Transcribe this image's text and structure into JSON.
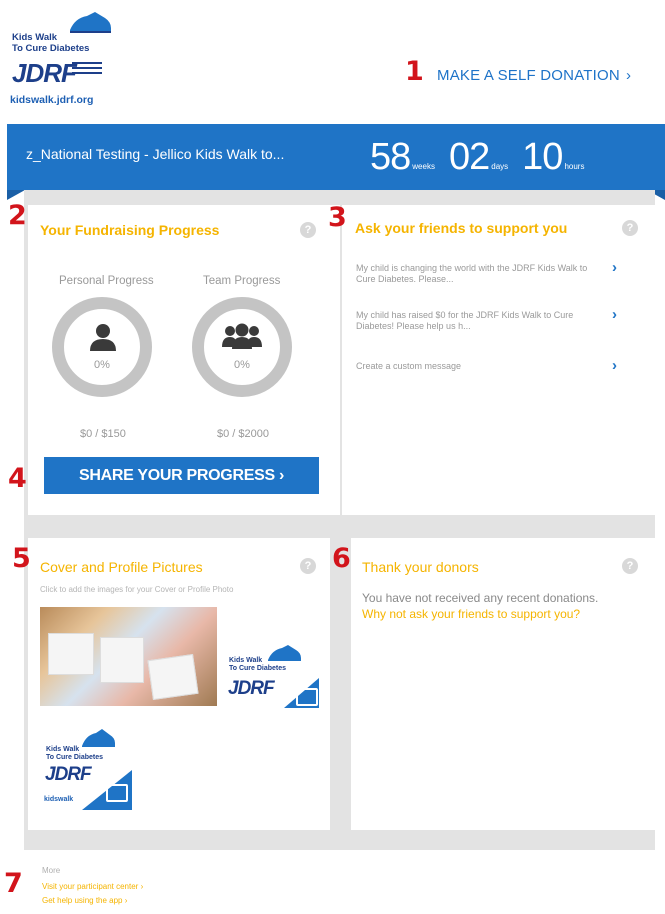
{
  "logo": {
    "line1": "Kids Walk",
    "line2": "To Cure Diabetes",
    "brand": "JDRF",
    "url": "kidswalk.jdrf.org"
  },
  "steps": [
    "1",
    "2",
    "3",
    "4",
    "5",
    "6",
    "7"
  ],
  "header": {
    "self_donation": "MAKE A SELF DONATION",
    "chevron": "›"
  },
  "banner": {
    "event_name": "z_National Testing - Jellico Kids Walk to...",
    "weeks_value": "58",
    "weeks_unit": "weeks",
    "days_value": "02",
    "days_unit": "days",
    "hours_value": "10",
    "hours_unit": "hours"
  },
  "fundraising": {
    "title": "Your Fundraising Progress",
    "help": "?",
    "personal_label": "Personal Progress",
    "team_label": "Team Progress",
    "personal_pct": "0%",
    "team_pct": "0%",
    "personal_amount": "$0 / $150",
    "team_amount": "$0 / $2000",
    "share_button": "SHARE YOUR PROGRESS ›",
    "icons": [
      "person-icon",
      "team-icon"
    ]
  },
  "friends": {
    "title": "Ask your friends to support you",
    "help": "?",
    "items": [
      "My child is changing the world with the JDRF Kids Walk to Cure Diabetes. Please...",
      "My child has raised $0 for the JDRF Kids Walk to Cure Diabetes! Please help us h...",
      "Create a custom message"
    ],
    "chevron": "›"
  },
  "pictures": {
    "title": "Cover and Profile Pictures",
    "help": "?",
    "hint": "Click to add the images for your Cover or Profile Photo",
    "mini_logo_line1": "Kids Walk",
    "mini_logo_line2": "To Cure Diabetes",
    "mini_brand": "JDRF",
    "mini_url": "kidswalk"
  },
  "donors": {
    "title": "Thank your donors",
    "help": "?",
    "text": "You have not received any recent donations.",
    "link": "Why not ask your friends to support you?"
  },
  "footer": {
    "more": "More",
    "participant_center": "Visit your participant center ›",
    "help_app": "Get help using the app ›"
  },
  "colors": {
    "accent_blue": "#1f74c6",
    "title_yellow": "#f5b400",
    "step_red": "#d2141b",
    "frame_grey": "#e3e3e3"
  }
}
